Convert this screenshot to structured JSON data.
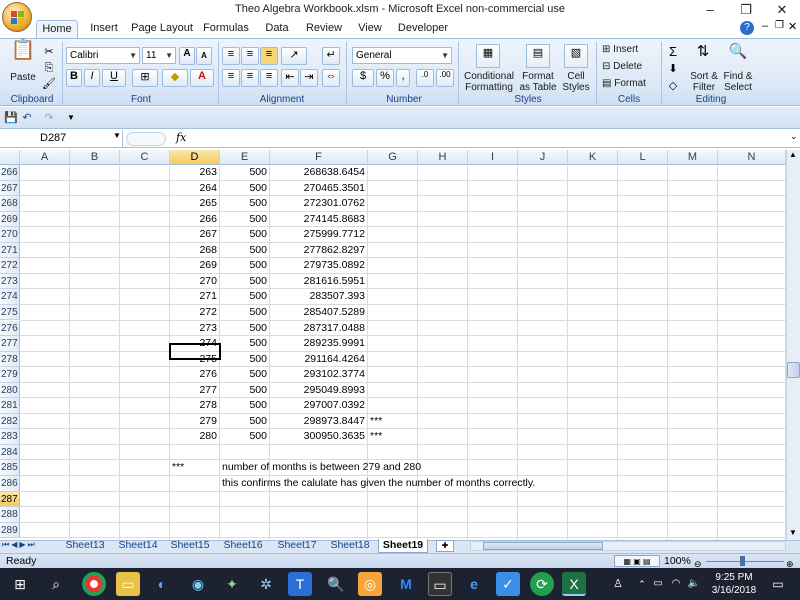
{
  "window": {
    "title": "Theo Algebra Workbook.xlsm  -  Microsoft Excel non-commercial use",
    "minimize": "–",
    "restore": "❐",
    "close": "✕"
  },
  "tabs": [
    "Home",
    "Insert",
    "Page Layout",
    "Formulas",
    "Data",
    "Review",
    "View",
    "Developer"
  ],
  "ribbon": {
    "clipboard": {
      "label": "Clipboard",
      "paste": "Paste"
    },
    "font": {
      "label": "Font",
      "name": "Calibri",
      "size": "11"
    },
    "alignment": {
      "label": "Alignment"
    },
    "number": {
      "label": "Number",
      "format": "General"
    },
    "styles": {
      "label": "Styles",
      "conditional": "Conditional Formatting",
      "format_table": "Format as Table",
      "cell_styles": "Cell Styles"
    },
    "cells": {
      "label": "Cells",
      "insert": "Insert",
      "delete": "Delete",
      "format": "Format"
    },
    "editing": {
      "label": "Editing",
      "sort": "Sort & Filter",
      "find": "Find & Select"
    }
  },
  "name_box": "D287",
  "fx": "fx",
  "columns": [
    "A",
    "B",
    "C",
    "D",
    "E",
    "F",
    "G",
    "H",
    "I",
    "J",
    "K",
    "L",
    "M",
    "N"
  ],
  "rows": [
    {
      "n": "266",
      "d": "263",
      "e": "500",
      "f": "268638.6454",
      "g": ""
    },
    {
      "n": "267",
      "d": "264",
      "e": "500",
      "f": "270465.3501",
      "g": ""
    },
    {
      "n": "268",
      "d": "265",
      "e": "500",
      "f": "272301.0762",
      "g": ""
    },
    {
      "n": "269",
      "d": "266",
      "e": "500",
      "f": "274145.8683",
      "g": ""
    },
    {
      "n": "270",
      "d": "267",
      "e": "500",
      "f": "275999.7712",
      "g": ""
    },
    {
      "n": "271",
      "d": "268",
      "e": "500",
      "f": "277862.8297",
      "g": ""
    },
    {
      "n": "272",
      "d": "269",
      "e": "500",
      "f": "279735.0892",
      "g": ""
    },
    {
      "n": "273",
      "d": "270",
      "e": "500",
      "f": "281616.5951",
      "g": ""
    },
    {
      "n": "274",
      "d": "271",
      "e": "500",
      "f": "283507.393",
      "g": ""
    },
    {
      "n": "275",
      "d": "272",
      "e": "500",
      "f": "285407.5289",
      "g": ""
    },
    {
      "n": "276",
      "d": "273",
      "e": "500",
      "f": "287317.0488",
      "g": ""
    },
    {
      "n": "277",
      "d": "274",
      "e": "500",
      "f": "289235.9991",
      "g": ""
    },
    {
      "n": "278",
      "d": "275",
      "e": "500",
      "f": "291164.4264",
      "g": ""
    },
    {
      "n": "279",
      "d": "276",
      "e": "500",
      "f": "293102.3774",
      "g": ""
    },
    {
      "n": "280",
      "d": "277",
      "e": "500",
      "f": "295049.8993",
      "g": ""
    },
    {
      "n": "281",
      "d": "278",
      "e": "500",
      "f": "297007.0392",
      "g": ""
    },
    {
      "n": "282",
      "d": "279",
      "e": "500",
      "f": "298973.8447",
      "g": "***"
    },
    {
      "n": "283",
      "d": "280",
      "e": "500",
      "f": "300950.3635",
      "g": "***"
    },
    {
      "n": "284",
      "d": "",
      "e": "",
      "f": "",
      "g": ""
    },
    {
      "n": "285",
      "d": "",
      "e": "",
      "f": "",
      "g": ""
    },
    {
      "n": "286",
      "d": "",
      "e": "",
      "f": "",
      "g": ""
    },
    {
      "n": "287",
      "d": "",
      "e": "",
      "f": "",
      "g": ""
    },
    {
      "n": "288",
      "d": "",
      "e": "",
      "f": "",
      "g": ""
    },
    {
      "n": "289",
      "d": "",
      "e": "",
      "f": "",
      "g": ""
    }
  ],
  "notes": {
    "stars": "***",
    "line1": "number of months is between 279 and 280",
    "line2": "this confirms the calulate has given the number of months correctly."
  },
  "sheets": [
    "Sheet13",
    "Sheet14",
    "Sheet15",
    "Sheet16",
    "Sheet17",
    "Sheet18",
    "Sheet19"
  ],
  "active_sheet": "Sheet19",
  "status": {
    "ready": "Ready",
    "zoom": "100%"
  },
  "clock": {
    "time": "9:25 PM",
    "date": "3/16/2018"
  }
}
